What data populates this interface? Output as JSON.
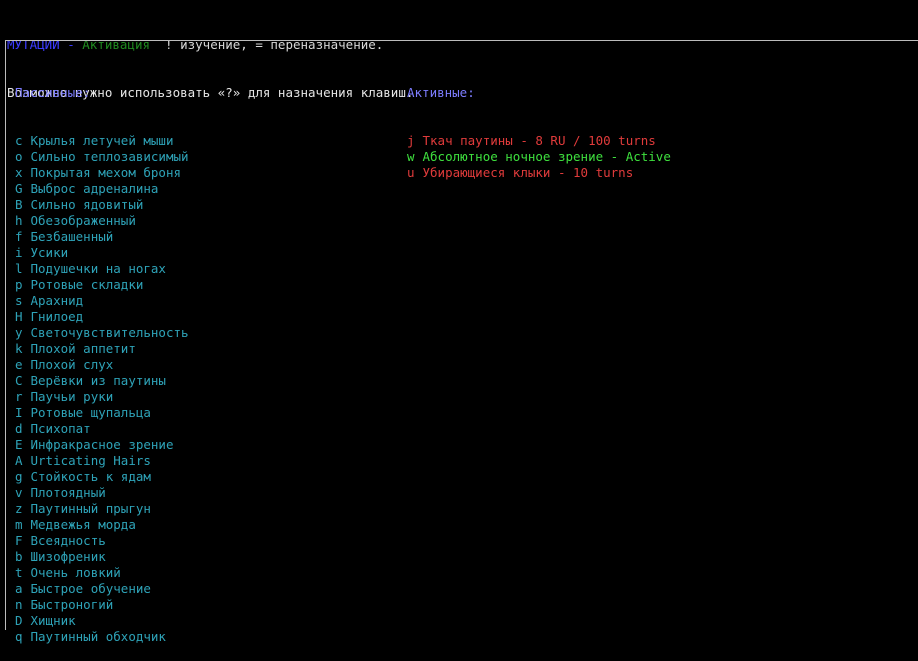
{
  "header": {
    "title_mutations": "МУТАЦИИ",
    "title_sep": " - ",
    "title_activation": "Активация",
    "title_help": "  ! изучение, = переназначение.",
    "line2": "Возможно нужно использовать «?» для назначения клавиш."
  },
  "passive": {
    "heading": "Пассивные:",
    "items": [
      {
        "key": "c",
        "label": "Крылья летучей мыши"
      },
      {
        "key": "o",
        "label": "Сильно теплозависимый"
      },
      {
        "key": "x",
        "label": "Покрытая мехом броня"
      },
      {
        "key": "G",
        "label": "Выброс адреналина"
      },
      {
        "key": "B",
        "label": "Сильно ядовитый"
      },
      {
        "key": "h",
        "label": "Обезображенный"
      },
      {
        "key": "f",
        "label": "Безбашенный"
      },
      {
        "key": "i",
        "label": "Усики"
      },
      {
        "key": "l",
        "label": "Подушечки на ногах"
      },
      {
        "key": "p",
        "label": "Ротовые складки"
      },
      {
        "key": "s",
        "label": "Арахнид"
      },
      {
        "key": "H",
        "label": "Гнилоед"
      },
      {
        "key": "y",
        "label": "Светочувствительность"
      },
      {
        "key": "k",
        "label": "Плохой аппетит"
      },
      {
        "key": "e",
        "label": "Плохой слух"
      },
      {
        "key": "C",
        "label": "Верёвки из паутины"
      },
      {
        "key": "r",
        "label": "Паучьи руки"
      },
      {
        "key": "I",
        "label": "Ротовые щупальца"
      },
      {
        "key": "d",
        "label": "Психопат"
      },
      {
        "key": "E",
        "label": "Инфракрасное зрение"
      },
      {
        "key": "A",
        "label": "Urticating Hairs"
      },
      {
        "key": "g",
        "label": "Стойкость к ядам"
      },
      {
        "key": "v",
        "label": "Плотоядный"
      },
      {
        "key": "z",
        "label": "Паутинный прыгун"
      },
      {
        "key": "m",
        "label": "Медвежья морда"
      },
      {
        "key": "F",
        "label": "Всеядность"
      },
      {
        "key": "b",
        "label": "Шизофреник"
      },
      {
        "key": "t",
        "label": "Очень ловкий"
      },
      {
        "key": "a",
        "label": "Быстрое обучение"
      },
      {
        "key": "n",
        "label": "Быстроногий"
      },
      {
        "key": "D",
        "label": "Хищник"
      },
      {
        "key": "q",
        "label": "Паутинный обходчик"
      }
    ]
  },
  "active": {
    "heading": "Активные:",
    "items": [
      {
        "key": "j",
        "label": "Ткач паутины - 8 RU / 100 turns",
        "color": "#e03b3b"
      },
      {
        "key": "w",
        "label": "Абсолютное ночное зрение - Active",
        "color": "#3ee03e"
      },
      {
        "key": "u",
        "label": "Убирающиеся клыки - 10 turns",
        "color": "#e03b3b"
      }
    ]
  }
}
